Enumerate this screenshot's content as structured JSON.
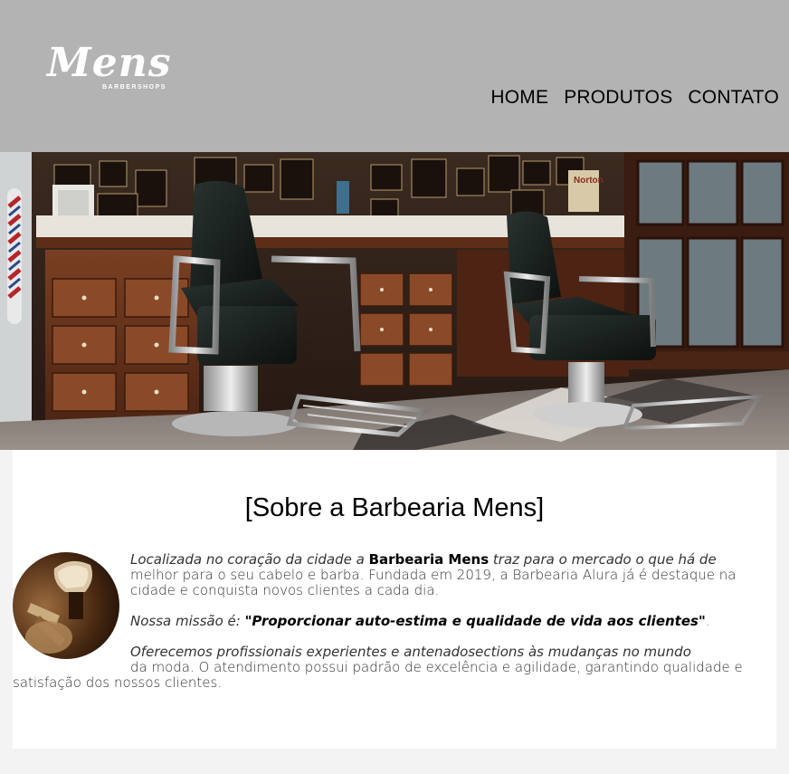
{
  "header": {
    "logo": {
      "word": "Mens",
      "subtitle": "BARBERSHOPS"
    },
    "nav": [
      "HOME",
      "PRODUTOS",
      "CONTATO"
    ]
  },
  "hero": {
    "icon": "barbershop-interior-photo"
  },
  "about": {
    "title": "[Sobre a Barbearia Mens]",
    "image_icon": "shaving-brush-photo",
    "p1_italic": "Localizada no coração da cidade a ",
    "p1_bold": "Barbearia Mens",
    "p1_italic2": " traz para o mercado o que há de",
    "p1_rest": "melhor para o seu cabelo e barba. Fundada em 2019, a Barbearia Alura já é destaque na cidade e conquista novos clientes a cada dia.",
    "p2_italic": "Nossa missão é: ",
    "p2_mission": "\"Proporcionar auto-estima e qualidade de vida aos clientes\"",
    "p2_end": ".",
    "p3_italic": "Oferecemos profissionais experientes e antenadosections às mudanças no mundo",
    "p3_rest": "da moda. O atendimento possui padrão de excelência e agilidade, garantindo qualidade e satisfação dos nossos clientes."
  },
  "colors": {
    "header_bg": "#b3b3b3",
    "page_bg": "#f3f3f3",
    "content_bg": "#ffffff"
  }
}
